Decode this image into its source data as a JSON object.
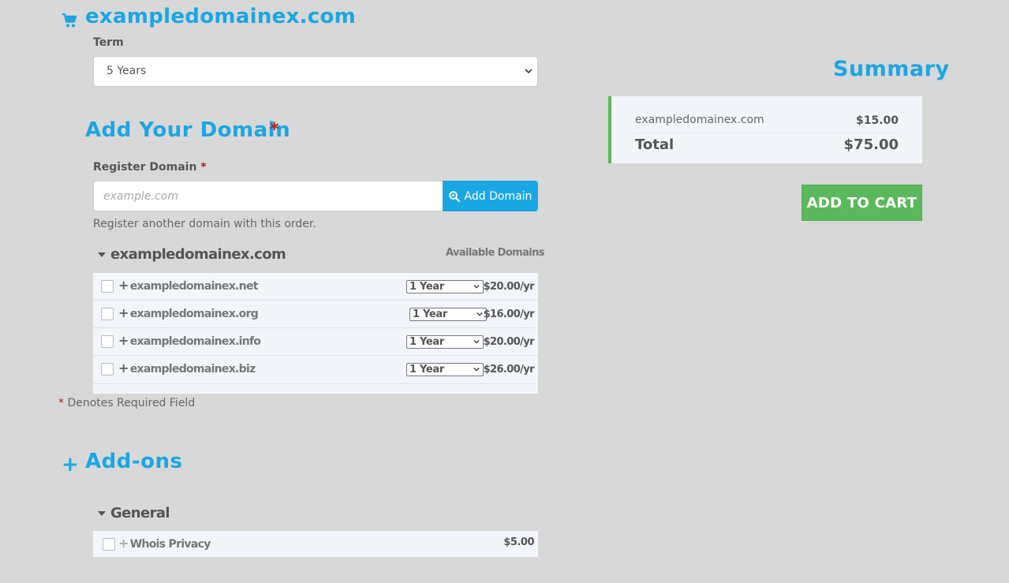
{
  "header": {
    "domain_title": "exampledomainex.com",
    "icon": "shopping-cart-icon"
  },
  "term": {
    "label": "Term",
    "selected": "5 Years"
  },
  "add_domain": {
    "title": "Add Your Domain",
    "required_star": "*",
    "register_label": "Register Domain",
    "register_star": "*",
    "input_placeholder": "example.com",
    "input_value": "",
    "button_label": "Add Domain",
    "button_icon": "zoom-in-icon",
    "hint": "Register another domain with this order."
  },
  "suggestions": {
    "group_name": "exampledomainex.com",
    "available_label": "Available Domains",
    "rows": [
      {
        "name": "exampledomainex.net",
        "term": "1 Year",
        "price": "$20.00/yr"
      },
      {
        "name": "exampledomainex.org",
        "term": "1 Year",
        "price": "$16.00/yr"
      },
      {
        "name": "exampledomainex.info",
        "term": "1 Year",
        "price": "$20.00/yr"
      },
      {
        "name": "exampledomainex.biz",
        "term": "1 Year",
        "price": "$26.00/yr"
      }
    ]
  },
  "required_note": {
    "star": "*",
    "text": "Denotes Required Field"
  },
  "addons": {
    "title": "Add-ons",
    "plus": "+",
    "group_name": "General",
    "items": [
      {
        "name": "Whois Privacy",
        "price": "$5.00"
      }
    ]
  },
  "summary": {
    "title": "Summary",
    "item_name": "exampledomainex.com",
    "item_price": "$15.00",
    "total_label": "Total",
    "total_price": "$75.00",
    "button_label": "ADD TO CART"
  },
  "colors": {
    "accent": "#1aa6e3",
    "success": "#5cb85c",
    "required": "#b01b1b",
    "background": "#d8d8d8"
  }
}
